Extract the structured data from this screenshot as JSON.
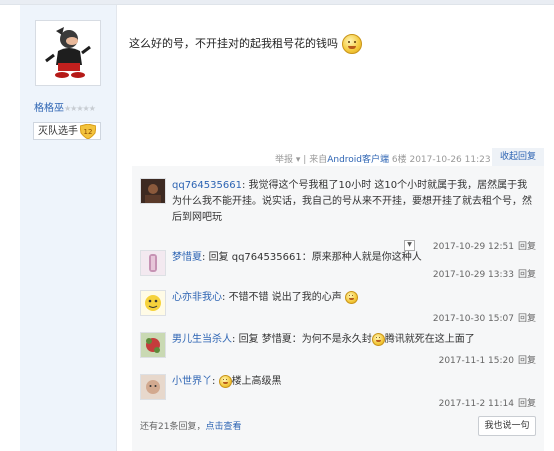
{
  "author": {
    "name": "格格巫",
    "stars": "★★★★★",
    "level_name": "灭队选手",
    "level_num": "12"
  },
  "post": {
    "text": "这么好的号，不开挂对的起我租号花的钱吗",
    "meta": {
      "report": "举报",
      "sep": "|",
      "from": "来自",
      "client": "Android客户端",
      "floor": "6楼",
      "time": "2017-10-26 11:23",
      "collapse": "收起回复"
    }
  },
  "replies": [
    {
      "user": "qq764535661",
      "text": "我觉得这个号我租了10小时 这10个小时就属于我，居然属于我 为什么我不能开挂。说实话，我自己的号从来不开挂，要想开挂了就去租个号，然后到网吧玩",
      "time": "2017-10-29 12:51",
      "reply": "回复"
    },
    {
      "user": "梦惜夏",
      "text": "回复 qq764535661：原来那种人就是你这种人",
      "time": "2017-10-29 13:33",
      "reply": "回复"
    },
    {
      "user": "心亦非我心",
      "text": "不错不错 说出了我的心声",
      "time": "2017-10-30 15:07",
      "reply": "回复"
    },
    {
      "user": "男儿生当杀人",
      "text_pre": "回复 梦惜夏：为何不是永久封",
      "text_post": "腾讯就死在这上面了",
      "time": "2017-11-1 15:20",
      "reply": "回复"
    },
    {
      "user": "小世界丫",
      "text": "楼上高级黑",
      "time": "2017-11-2 11:14",
      "reply": "回复"
    }
  ],
  "footer": {
    "more_prefix": "还有21条回复，",
    "more_link": "点击查看",
    "say_button": "我也说一句"
  }
}
